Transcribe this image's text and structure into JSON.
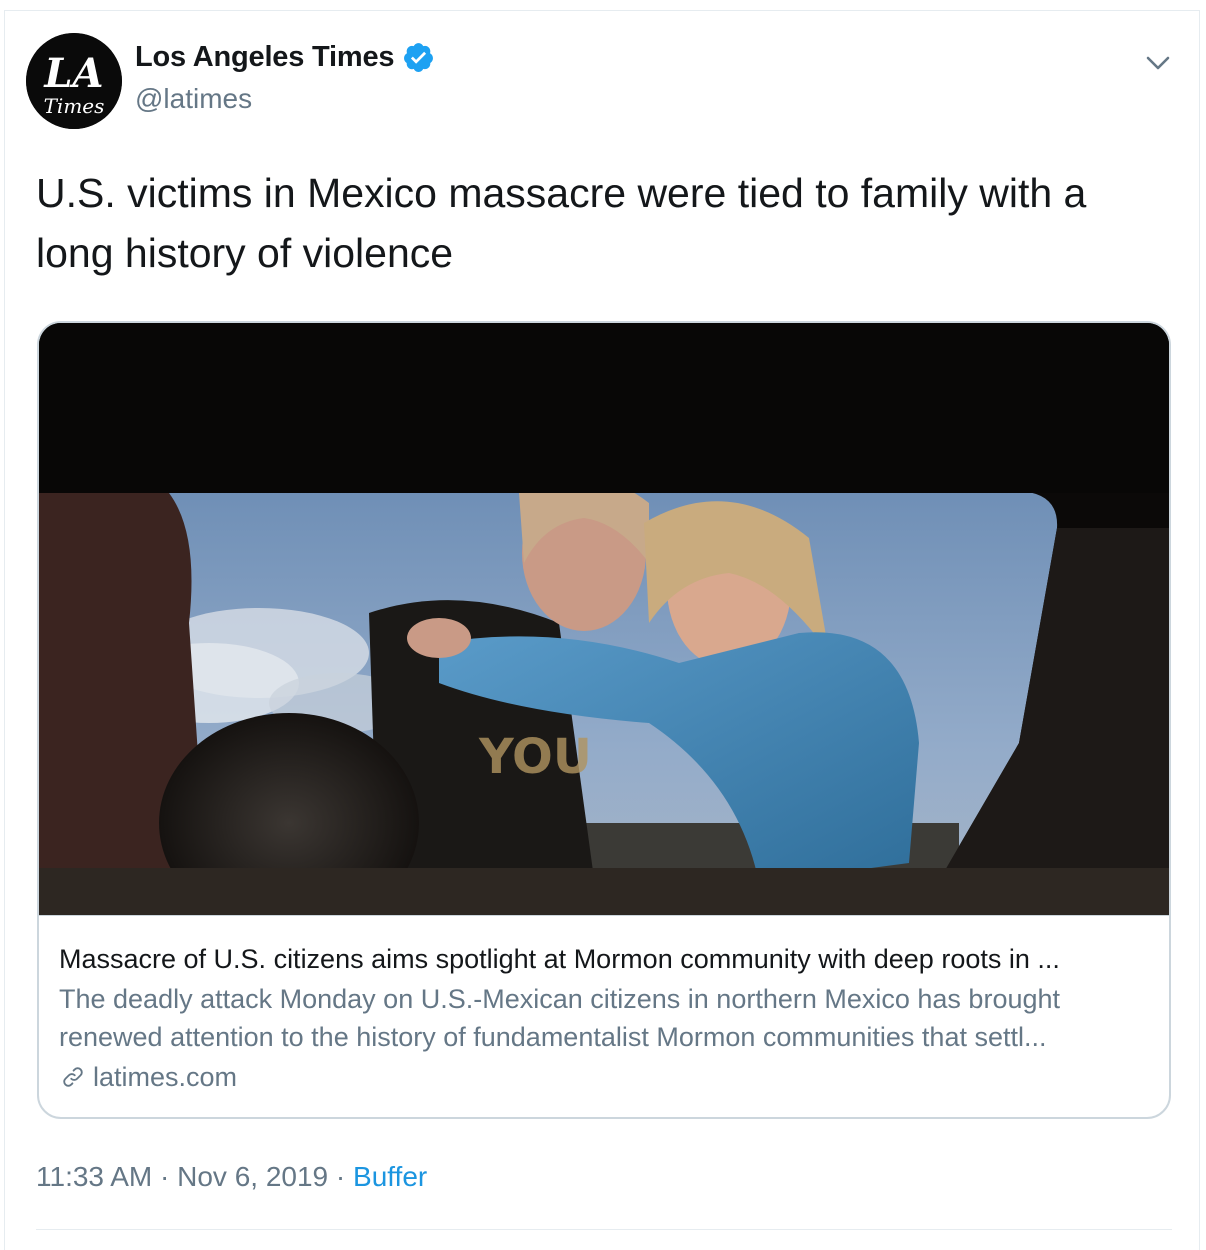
{
  "author": {
    "name": "Los Angeles Times",
    "handle": "@latimes",
    "avatar_text": "LA Times",
    "verified_icon": "verified-badge-icon"
  },
  "tweet": {
    "text": "U.S. victims in Mexico massacre were tied to family with a long history of violence"
  },
  "card": {
    "title": "Massacre of U.S. citizens aims spotlight at Mormon community with deep roots in ...",
    "description": "The deadly attack Monday on U.S.-Mexican citizens in northern Mexico has brought renewed attention to the history of fundamentalist Mormon communities that settl...",
    "domain": "latimes.com",
    "image_alt": "Two girls embrace and cry, framed through the burned-out window of a vehicle"
  },
  "meta": {
    "time": "11:33 AM",
    "separator": "·",
    "date": "Nov 6, 2019",
    "source": "Buffer"
  },
  "colors": {
    "link_blue": "#1b95e0",
    "secondary_text": "#657786",
    "verified_blue": "#1da1f2",
    "border": "#ccd6dd"
  }
}
